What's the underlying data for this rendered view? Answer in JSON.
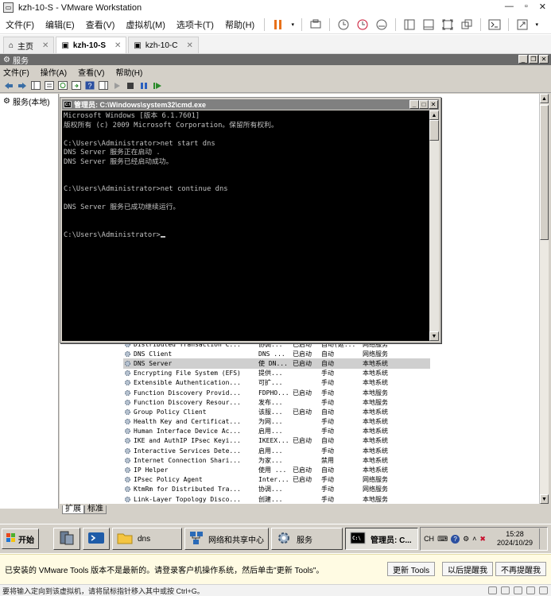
{
  "window": {
    "title": "kzh-10-S - VMware Workstation"
  },
  "menu": [
    "文件(F)",
    "编辑(E)",
    "查看(V)",
    "虚拟机(M)",
    "选项卡(T)",
    "帮助(H)"
  ],
  "tabs": [
    {
      "label": "主页"
    },
    {
      "label": "kzh-10-S"
    },
    {
      "label": "kzh-10-C"
    }
  ],
  "services": {
    "title": "服务",
    "menu": [
      "文件(F)",
      "操作(A)",
      "查看(V)",
      "帮助(H)"
    ],
    "tree_item": "服务(本地)",
    "rows": [
      {
        "name": "Distributed Transaction C...",
        "desc": "协调...",
        "status": "已启动",
        "startup": "自动(延...",
        "logon": "网络服务"
      },
      {
        "name": "DNS Client",
        "desc": "DNS ...",
        "status": "已启动",
        "startup": "自动",
        "logon": "网络服务"
      },
      {
        "name": "DNS Server",
        "desc": "使 DN...",
        "status": "已启动",
        "startup": "自动",
        "logon": "本地系统",
        "selected": true
      },
      {
        "name": "Encrypting File System (EFS)",
        "desc": "提供...",
        "status": "",
        "startup": "手动",
        "logon": "本地系统"
      },
      {
        "name": "Extensible Authentication...",
        "desc": "可扩...",
        "status": "",
        "startup": "手动",
        "logon": "本地系统"
      },
      {
        "name": "Function Discovery Provid...",
        "desc": "FDPHO...",
        "status": "已启动",
        "startup": "手动",
        "logon": "本地服务"
      },
      {
        "name": "Function Discovery Resour...",
        "desc": "发布...",
        "status": "",
        "startup": "手动",
        "logon": "本地服务"
      },
      {
        "name": "Group Policy Client",
        "desc": "该服...",
        "status": "已启动",
        "startup": "自动",
        "logon": "本地系统"
      },
      {
        "name": "Health Key and Certificat...",
        "desc": "为网...",
        "status": "",
        "startup": "手动",
        "logon": "本地系统"
      },
      {
        "name": "Human Interface Device Ac...",
        "desc": "启用...",
        "status": "",
        "startup": "手动",
        "logon": "本地系统"
      },
      {
        "name": "IKE and AuthIP IPsec Keyi...",
        "desc": "IKEEX...",
        "status": "已启动",
        "startup": "自动",
        "logon": "本地系统"
      },
      {
        "name": "Interactive Services Dete...",
        "desc": "启用...",
        "status": "",
        "startup": "手动",
        "logon": "本地系统"
      },
      {
        "name": "Internet Connection Shari...",
        "desc": "为家...",
        "status": "",
        "startup": "禁用",
        "logon": "本地系统"
      },
      {
        "name": "IP Helper",
        "desc": "使用 ...",
        "status": "已启动",
        "startup": "自动",
        "logon": "本地系统"
      },
      {
        "name": "IPsec Policy Agent",
        "desc": "Inter...",
        "status": "已启动",
        "startup": "手动",
        "logon": "网络服务"
      },
      {
        "name": "KtmRm for Distributed Tra...",
        "desc": "协调...",
        "status": "",
        "startup": "手动",
        "logon": "网络服务"
      },
      {
        "name": "Link-Layer Topology Disco...",
        "desc": "创建...",
        "status": "",
        "startup": "手动",
        "logon": "本地服务"
      }
    ],
    "bottom_tabs": [
      "扩展",
      "标准"
    ]
  },
  "cmd": {
    "title": "管理员: C:\\Windows\\system32\\cmd.exe",
    "lines": [
      "Microsoft Windows [版本 6.1.7601]",
      "版权所有 (c) 2009 Microsoft Corporation。保留所有权利。",
      "",
      "C:\\Users\\Administrator>net start dns",
      "DNS Server 服务正在启动 .",
      "DNS Server 服务已经启动成功。",
      "",
      "",
      "C:\\Users\\Administrator>net continue dns",
      "",
      "DNS Server 服务已成功继续运行。",
      "",
      "",
      "C:\\Users\\Administrator>"
    ]
  },
  "taskbar": {
    "start": "开始",
    "items": [
      {
        "label": ""
      },
      {
        "label": ""
      },
      {
        "label": "dns"
      },
      {
        "label": "网络和共享中心"
      },
      {
        "label": "服务"
      },
      {
        "label": "管理员: C..."
      }
    ],
    "lang": "CH",
    "time": "15:28",
    "date": "2024/10/29"
  },
  "notification": {
    "text": "已安装的 VMware Tools 版本不是最新的。请登录客户机操作系统，然后单击\"更新 Tools\"。",
    "update_btn": "更新 Tools",
    "later_btn": "以后提醒我",
    "never_btn": "不再提醒我"
  },
  "statusbar": {
    "text": "要将输入定向到该虚拟机，请将鼠标指针移入其中或按 Ctrl+G。"
  }
}
